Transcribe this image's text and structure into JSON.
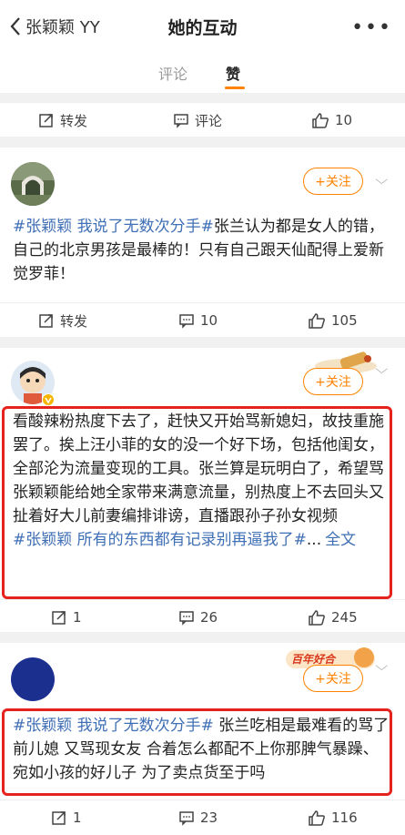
{
  "header": {
    "back_label": "张颖颖 YY",
    "title": "她的互动",
    "more": "•••"
  },
  "tabs": {
    "comment": "评论",
    "like": "赞"
  },
  "post0": {
    "repost": "转发",
    "comment": "评论",
    "likes": "10"
  },
  "post1": {
    "follow": "+关注",
    "text_tag": "#张颖颖 我说了无数次分手#",
    "text_body": "张兰认为都是女人的错，自己的北京男孩是最棒的！只有自己跟天仙配得上爱新觉罗菲！",
    "repost": "转发",
    "comments": "10",
    "likes": "105"
  },
  "post2": {
    "follow": "+关注",
    "text_body": "看酸辣粉热度下去了，赶快又开始骂新媳妇，故技重施罢了。挨上汪小菲的女的没一个好下场，包括他闺女，全部沦为流量变现的工具。张兰算是玩明白了，希望骂张颖颖能给她全家带来满意流量，别热度上不去回头又扯着好大儿前妻编排诽谤，直播跟孙子孙女视频",
    "text_tag": "#张颖颖 所有的东西都有记录别再逼我了#",
    "ellipsis": "...",
    "full_text": "全文",
    "reposts": "1",
    "comments": "26",
    "likes": "245"
  },
  "post3": {
    "follow": "+关注",
    "badge": "百年好合",
    "text_tag": "#张颖颖 我说了无数次分手#",
    "text_body": " 张兰吃相是最难看的骂了前儿媳 又骂现女友 合着怎么都配不上你那脾气暴躁、宛如小孩的好儿子 为了卖点货至于吗",
    "reposts": "1",
    "comments": "23",
    "likes": "116"
  },
  "colors": {
    "accent": "#ff8200",
    "tag": "#3f6fb5",
    "highlight": "#e5221e"
  }
}
